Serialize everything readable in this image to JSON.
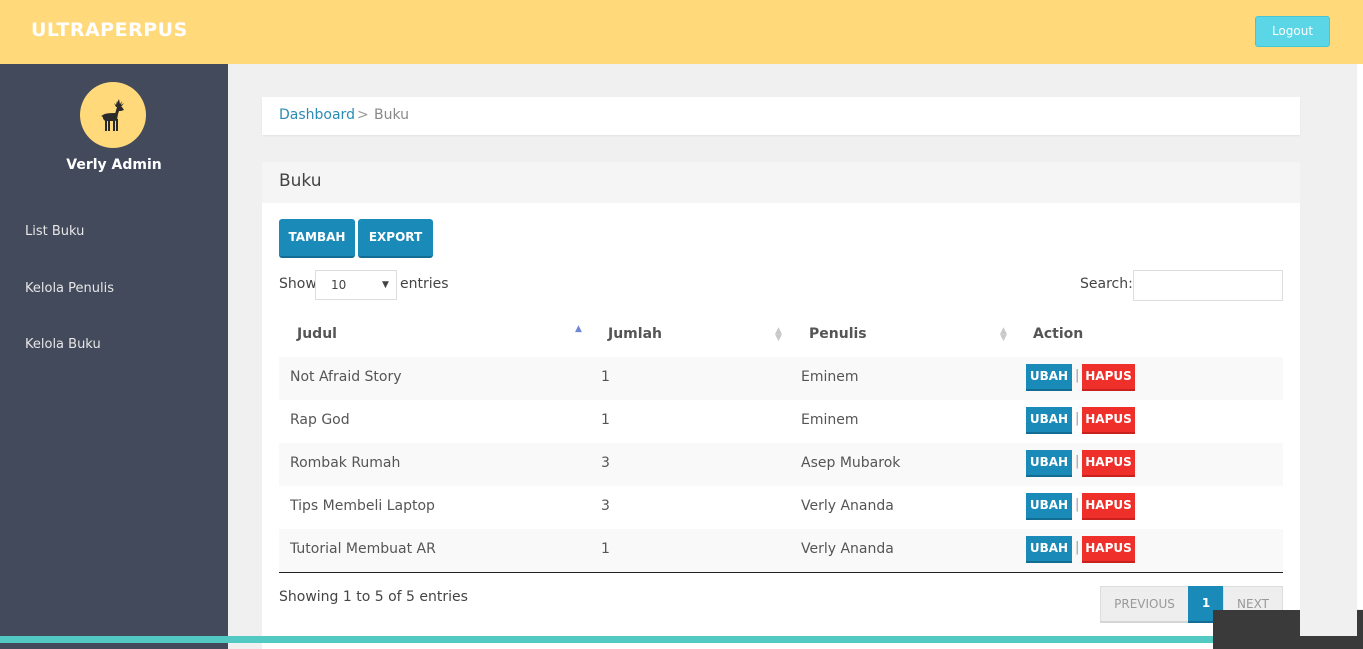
{
  "app": {
    "brand": "ULTRAPERPUS",
    "logout_label": "Logout"
  },
  "sidebar": {
    "user_name": "Verly Admin",
    "items": [
      {
        "label": "List Buku"
      },
      {
        "label": "Kelola Penulis"
      },
      {
        "label": "Kelola Buku"
      }
    ]
  },
  "breadcrumb": {
    "root": "Dashboard",
    "separator": ">",
    "current": "Buku"
  },
  "panel": {
    "title": "Buku",
    "add_label": "TAMBAH",
    "export_label": "EXPORT"
  },
  "table_controls": {
    "show_label": "Show",
    "entries_value": "10",
    "entries_label": "entries",
    "search_label": "Search:",
    "search_value": ""
  },
  "table": {
    "headers": [
      "Judul",
      "Jumlah",
      "Penulis",
      "Action"
    ],
    "rows": [
      {
        "judul": "Not Afraid Story",
        "jumlah": "1",
        "penulis": "Eminem"
      },
      {
        "judul": "Rap God",
        "jumlah": "1",
        "penulis": "Eminem"
      },
      {
        "judul": "Rombak Rumah",
        "jumlah": "3",
        "penulis": "Asep Mubarok"
      },
      {
        "judul": "Tips Membeli Laptop",
        "jumlah": "3",
        "penulis": "Verly Ananda"
      },
      {
        "judul": "Tutorial Membuat AR",
        "jumlah": "1",
        "penulis": "Verly Ananda"
      }
    ],
    "edit_label": "UBAH",
    "delete_label": "HAPUS",
    "action_separator": "|"
  },
  "footer": {
    "info": "Showing 1 to 5 of 5 entries",
    "previous_label": "PREVIOUS",
    "current_page": "1",
    "next_label": "NEXT"
  },
  "colors": {
    "topbar": "#ffd97a",
    "sidebar": "#434a5c",
    "primary": "#1a8ab8",
    "danger": "#ef2f2a",
    "logout": "#5bd6e6",
    "accent_bar": "#52c9c2"
  },
  "icons": {
    "avatar": "deer-icon"
  }
}
